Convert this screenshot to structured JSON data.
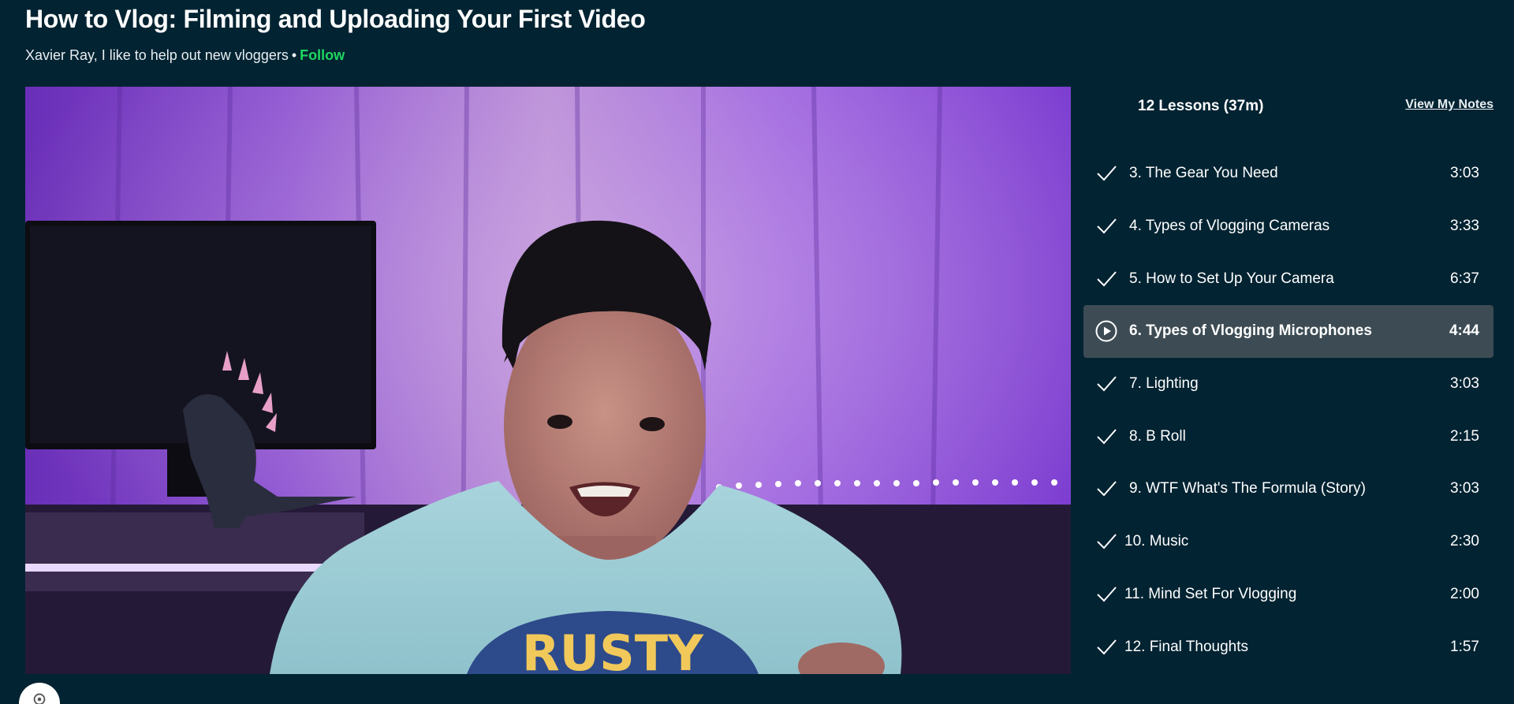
{
  "course": {
    "title": "How to Vlog: Filming and Uploading Your First Video",
    "author": "Xavier Ray, I like to help out new vloggers",
    "separator": "•",
    "follow_label": "Follow"
  },
  "video": {
    "shirt_text": "RUSTY"
  },
  "lessons_panel": {
    "header": "12 Lessons (37m)",
    "view_notes_label": "View My Notes",
    "lessons": [
      {
        "title": "3. The Gear You Need",
        "duration": "3:03",
        "status": "completed",
        "icon": "check-icon"
      },
      {
        "title": "4. Types of Vlogging Cameras",
        "duration": "3:33",
        "status": "completed",
        "icon": "check-icon"
      },
      {
        "title": "5. How to Set Up Your Camera",
        "duration": "6:37",
        "status": "completed",
        "icon": "check-icon"
      },
      {
        "title": "6. Types of Vlogging Microphones",
        "duration": "4:44",
        "status": "playing",
        "icon": "play-circle-icon"
      },
      {
        "title": "7. Lighting",
        "duration": "3:03",
        "status": "completed",
        "icon": "check-icon"
      },
      {
        "title": "8. B Roll",
        "duration": "2:15",
        "status": "completed",
        "icon": "check-icon"
      },
      {
        "title": "9. WTF What's The Formula (Story)",
        "duration": "3:03",
        "status": "completed",
        "icon": "check-icon"
      },
      {
        "title": "10. Music",
        "duration": "2:30",
        "status": "completed",
        "icon": "check-icon"
      },
      {
        "title": "11. Mind Set For Vlogging",
        "duration": "2:00",
        "status": "completed",
        "icon": "check-icon"
      },
      {
        "title": "12. Final Thoughts",
        "duration": "1:57",
        "status": "completed",
        "icon": "check-icon"
      }
    ]
  },
  "settings": {
    "icon": "gear-icon"
  },
  "colors": {
    "background": "#022332",
    "accent": "#1ed760",
    "active_row": "#3d4c54"
  }
}
